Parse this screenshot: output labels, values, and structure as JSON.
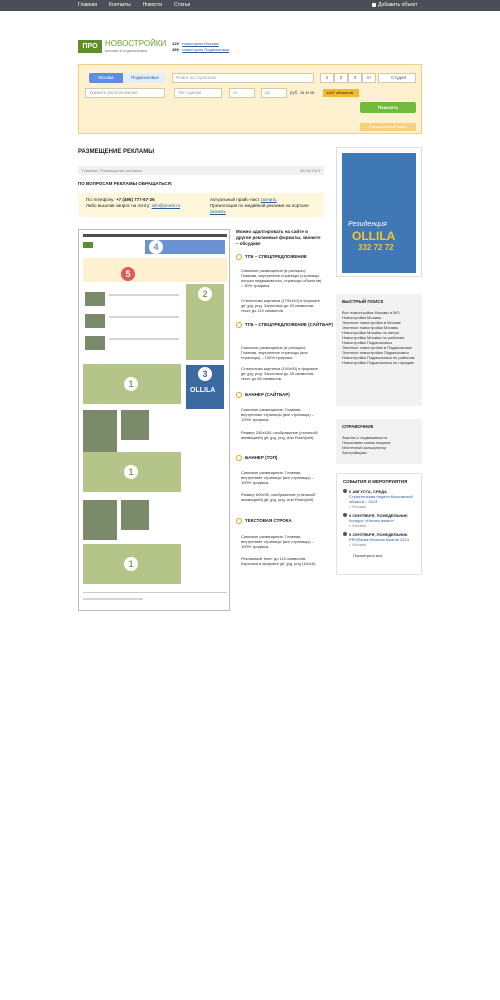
{
  "topbar": {
    "nav": [
      "Главная",
      "Контакты",
      "Новости",
      "Статьи"
    ],
    "add_object": "Добавить объект"
  },
  "logo": {
    "mark": "ПРО",
    "title": "НОВОСТРОЙКИ",
    "subtitle": "москвы и подмосковья"
  },
  "counts": {
    "moscow_num": "129",
    "moscow_label": "новостроек Москвы",
    "region_num": "459",
    "region_label": "новостроек Подмосковья"
  },
  "search": {
    "city_moscow": "Москва",
    "city_region": "Подмосковье",
    "placeholder": "Поиск по строению",
    "rooms": [
      "1",
      "2",
      "3",
      "4+"
    ],
    "studio": "Студия",
    "location_placeholder": "Укажите расположение",
    "type_placeholder": "Тип сделки",
    "price_from": "от",
    "price_to": "до",
    "price_unit": "руб. за м кв",
    "found_badge": "1447 объектов",
    "show_button": "Показать",
    "extended_button": "Расширенный поиск"
  },
  "main": {
    "title": "РАЗМЕЩЕНИЕ РЕКЛАМЫ",
    "breadcrumb": "Главная  /  Размещение рекламы",
    "date": "08.08.2013",
    "contact_heading": "ПО ВОПРОСАМ РЕКЛАМЫ ОБРАЩАТЬСЯ:",
    "phone_label": "По телефону:",
    "phone": "+7 (495) 777-67-26",
    "email_label": "Либо вышлав запрос на почту:",
    "email": "info@prorel.ru",
    "pricelist_label": "Актуальный прайс-лист",
    "pricelist_link": "скачать",
    "presentation_label": "Презентация по медийной рекламе на портале",
    "presentation_link": "скачать"
  },
  "preview": {
    "numbers": [
      "4",
      "5",
      "2",
      "3",
      "1",
      "1",
      "1"
    ],
    "banner_text": "OLLILA"
  },
  "ads": {
    "intro": "Можно адаптировать на сайте и другие рекламные форматы, звоните – обсудим!",
    "items": [
      {
        "num": "1",
        "title": "ТГБ – СПЕЦПРЕДЛОЖЕНИЕ",
        "text1": "Сквозное размещение (в ротации): Главная, внутренние страницы (страницы поиска недвижимости, страницы объектов) – 90% трафика.",
        "text2": "Стилистика картинки (179x110) в формате gif, jpg, png. Заголовок до 40 символов, текст до 110 символов."
      },
      {
        "num": "2",
        "title": "ТГБ – СПЕЦПРЕДЛОЖЕНИЕ (САЙТБАР)",
        "text1": "Сквозное размещение (в ротации): Главная, внутренние страницы (все страницы) – 100% трафика.",
        "text2": "Стилистика картинки (100x90) в формате gif, jpg, png. Заголовок до 35 символов, текст до 80 символов."
      },
      {
        "num": "3",
        "title": "БАННЕР (САЙТБАР)",
        "text1": "Сквозное размещение: Главная, внутренние страницы (все страницы) – 100% трафика.",
        "text2": "Размер 240x400, изображение (статикой/анимацией) gif, jpg, png, или Flash(swf)."
      },
      {
        "num": "4",
        "title": "БАННЕР (ТОП)",
        "text1": "Сквозное размещение: Главная, внутренние страницы (все страницы) – 100% трафика.",
        "text2": "Размер 609x90, изображение (статикой/анимацией) gif, jpg, png, или Flash(swf)."
      },
      {
        "num": "5",
        "title": "ТЕКСТОВАЯ СТРОКА",
        "text1": "Сквозное размещение: Главная, внутренние страницы (все страницы) – 100% трафика.",
        "text2": "Рекламный текст до 110 символов. Картинка в формате gif, jpg, png (16x16)"
      }
    ]
  },
  "banner": {
    "line1": "Резиденция",
    "brand": "OLLILA",
    "phone": "332 72 72"
  },
  "quick_search": {
    "title": "БЫСТРЫЙ ПОИСК",
    "links": [
      "Все новостройки Москвы и МО",
      "Новостройки Москвы",
      "Элитные новостройки в Москве",
      "Элитные новостройки Москвы",
      "Новостройки Москвы по метро",
      "Новостройки Москвы по районам",
      "Новостройки Подмосковья",
      "Элитные новостройки в Подмосковье",
      "Элитные новостройки Подмосковья",
      "Новостройки Подмосковья по районам",
      "Новостройки Подмосковья по городам"
    ]
  },
  "reference": {
    "title": "СПРАВОЧНИК",
    "links": [
      "Законы о недвижимости",
      "Пошаговая схема покупки",
      "Ипотечный калькулятор",
      "Застройщики"
    ]
  },
  "events": {
    "title": "СОБЫТИЯ И МЕРОПРИЯТИЯ",
    "items": [
      {
        "date": "6 АВГУСТА, СРЕДА",
        "title": "Строительная неделя Московской области – 2013",
        "city": "г. Москва"
      },
      {
        "date": "9 СЕНТЯБРЯ, ПОНЕДЕЛЬНИК",
        "title": "Конкурс «Homes award»",
        "city": "г. Москва"
      },
      {
        "date": "9 СЕНТЯБРЯ, ПОНЕДЕЛЬНИК",
        "title": "PROEstate Moscow Awards 2013",
        "city": "г. Москва"
      }
    ],
    "all_link": "Посмотреть все"
  },
  "colors": {
    "accent_green": "#5f8e2f",
    "panel_yellow": "#fdf1cf",
    "topbar": "#4a4f55",
    "link_blue": "#2a5d9f"
  }
}
